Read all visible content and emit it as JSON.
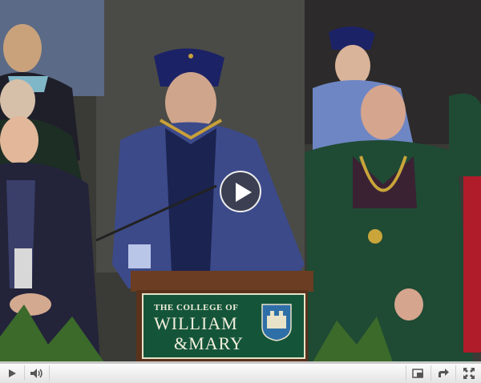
{
  "video": {
    "sign": {
      "line1": "THE COLLEGE OF",
      "line2": "WILLIAM",
      "line3": "&MARY"
    },
    "colors": {
      "podium_green": "#14553a",
      "accent_red": "#cc181e"
    }
  },
  "overlay": {
    "icon": "play-icon"
  },
  "controls": {
    "progress_fraction": 0,
    "icons": [
      "play-icon",
      "volume-icon",
      "popout-icon",
      "share-icon",
      "fullscreen-icon"
    ]
  }
}
